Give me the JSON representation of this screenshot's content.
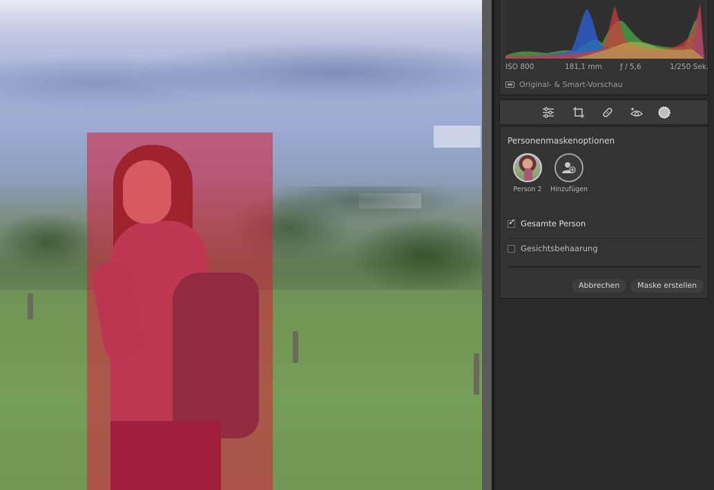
{
  "exif": {
    "iso": "ISO 800",
    "focal_length": "181,1 mm",
    "aperture": "ƒ / 5,6",
    "shutter": "1/250 Sek."
  },
  "preview": {
    "label": "Original- & Smart-Vorschau",
    "icon": "film-icon"
  },
  "toolbar": {
    "tools": [
      {
        "name": "edit-sliders-icon"
      },
      {
        "name": "crop-icon"
      },
      {
        "name": "heal-icon"
      },
      {
        "name": "red-eye-icon"
      },
      {
        "name": "masking-icon"
      }
    ]
  },
  "mask_options": {
    "title": "Personenmaskenoptionen",
    "people": [
      {
        "label": "Person 2"
      },
      {
        "label": "Hinzufügen"
      }
    ],
    "options": [
      {
        "label": "Gesamte Person",
        "checked": true
      },
      {
        "label": "Gesichtsbehaarung",
        "checked": false
      }
    ],
    "cancel_label": "Abbrechen",
    "create_label": "Maske erstellen"
  },
  "colors": {
    "mask_overlay": "#d71e3c",
    "panel_bg": "#333333",
    "histogram_blue": "#2a5fd0",
    "histogram_red": "#d23a3a",
    "histogram_green": "#4aa84a",
    "histogram_yellow": "#c8b84a"
  }
}
